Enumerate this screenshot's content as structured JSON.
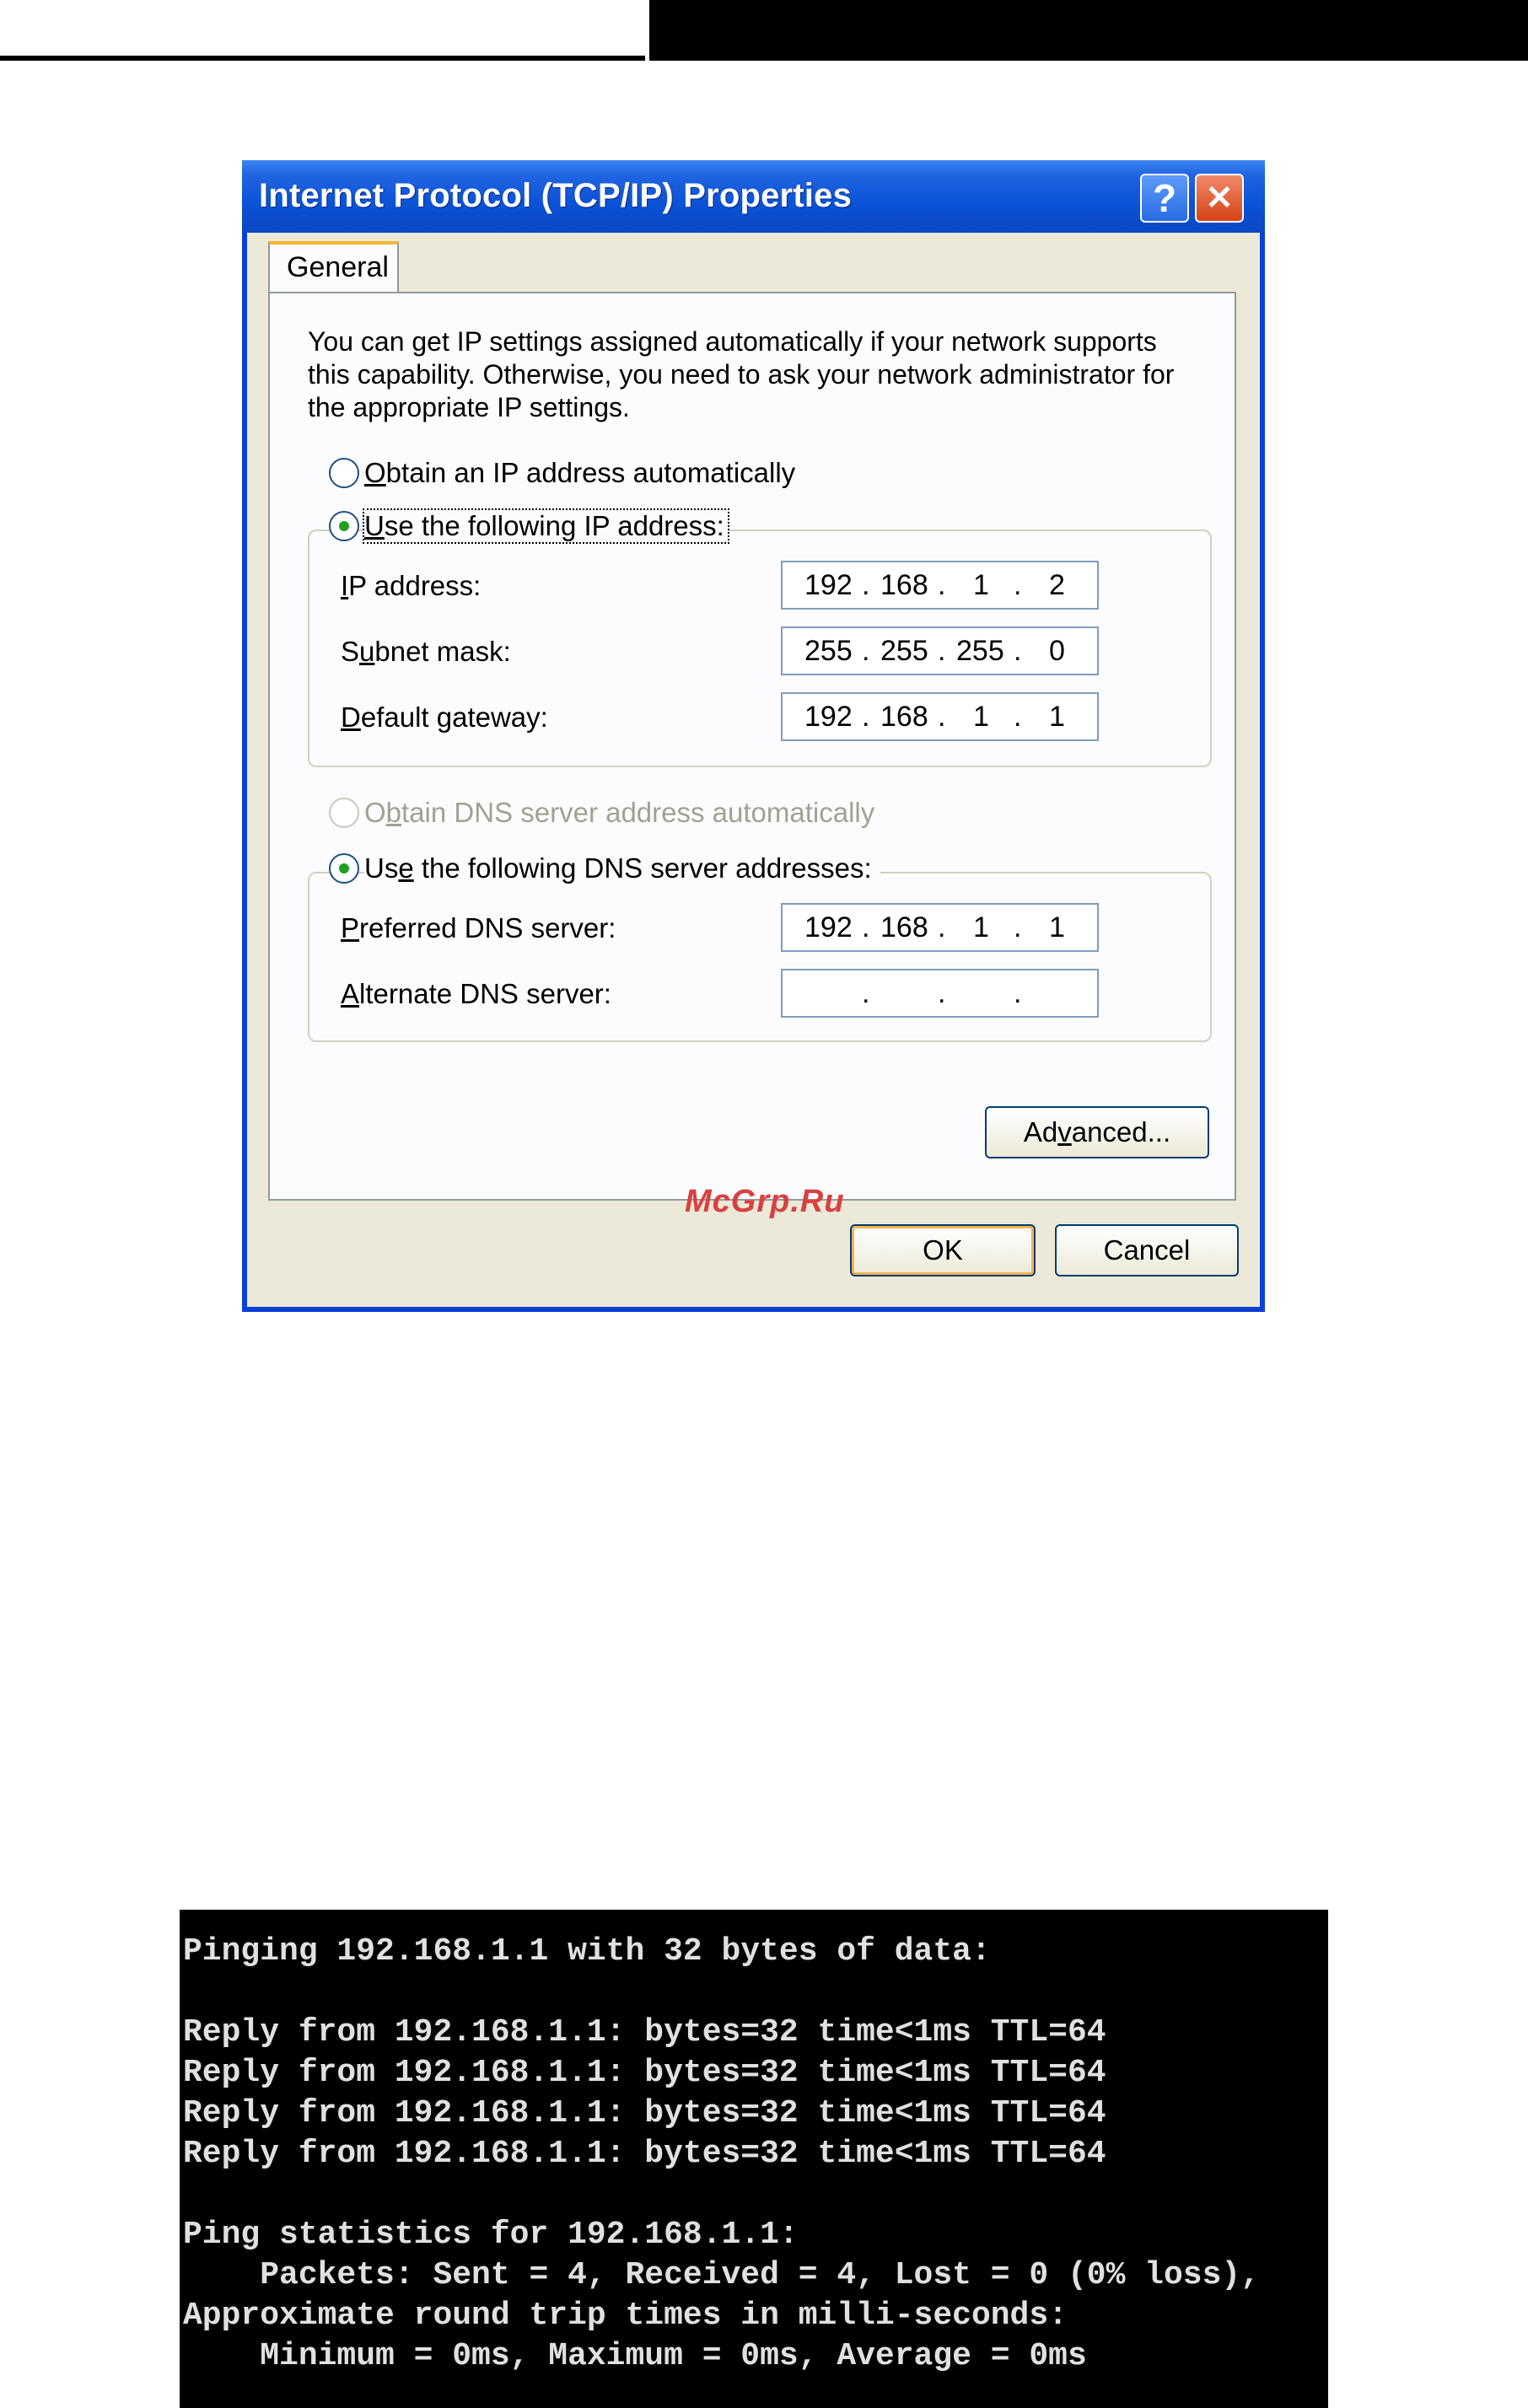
{
  "dialog": {
    "title": "Internet Protocol (TCP/IP) Properties",
    "help_label": "?",
    "close_label": "✕",
    "tab_general": "General",
    "description": "You can get IP settings assigned automatically if your network supports this capability. Otherwise, you need to ask your network administrator for the appropriate IP settings.",
    "ip_auto": {
      "first": "O",
      "rest": "btain an IP address automatically"
    },
    "ip_manual": {
      "first": "U",
      "rest": "se the following IP address:"
    },
    "ip_address": {
      "first": "I",
      "rest": "P address:",
      "octets": [
        "192",
        "168",
        "1",
        "2"
      ]
    },
    "subnet": {
      "pre": "S",
      "u": "u",
      "rest": "bnet mask:",
      "octets": [
        "255",
        "255",
        "255",
        "0"
      ]
    },
    "gateway": {
      "first": "D",
      "rest": "efault gateway:",
      "octets": [
        "192",
        "168",
        "1",
        "1"
      ]
    },
    "dns_auto": {
      "pre": "O",
      "u": "b",
      "rest": "tain DNS server address automatically"
    },
    "dns_manual": {
      "pre": "Us",
      "u": "e",
      "rest": " the following DNS server addresses:"
    },
    "preferred_dns": {
      "first": "P",
      "rest": "referred DNS server:",
      "octets": [
        "192",
        "168",
        "1",
        "1"
      ]
    },
    "alternate_dns": {
      "first": "A",
      "rest": "lternate DNS server:",
      "octets": [
        "",
        "",
        "",
        ""
      ]
    },
    "advanced": {
      "pre": "Ad",
      "u": "v",
      "rest": "anced..."
    },
    "ok_label": "OK",
    "cancel_label": "Cancel",
    "dot": "."
  },
  "watermark": "McGrp.Ru",
  "console": {
    "text": "Pinging 192.168.1.1 with 32 bytes of data:\n\nReply from 192.168.1.1: bytes=32 time<1ms TTL=64\nReply from 192.168.1.1: bytes=32 time<1ms TTL=64\nReply from 192.168.1.1: bytes=32 time<1ms TTL=64\nReply from 192.168.1.1: bytes=32 time<1ms TTL=64\n\nPing statistics for 192.168.1.1:\n    Packets: Sent = 4, Received = 4, Lost = 0 (0% loss),\nApproximate round trip times in milli-seconds:\n    Minimum = 0ms, Maximum = 0ms, Average = 0ms"
  }
}
